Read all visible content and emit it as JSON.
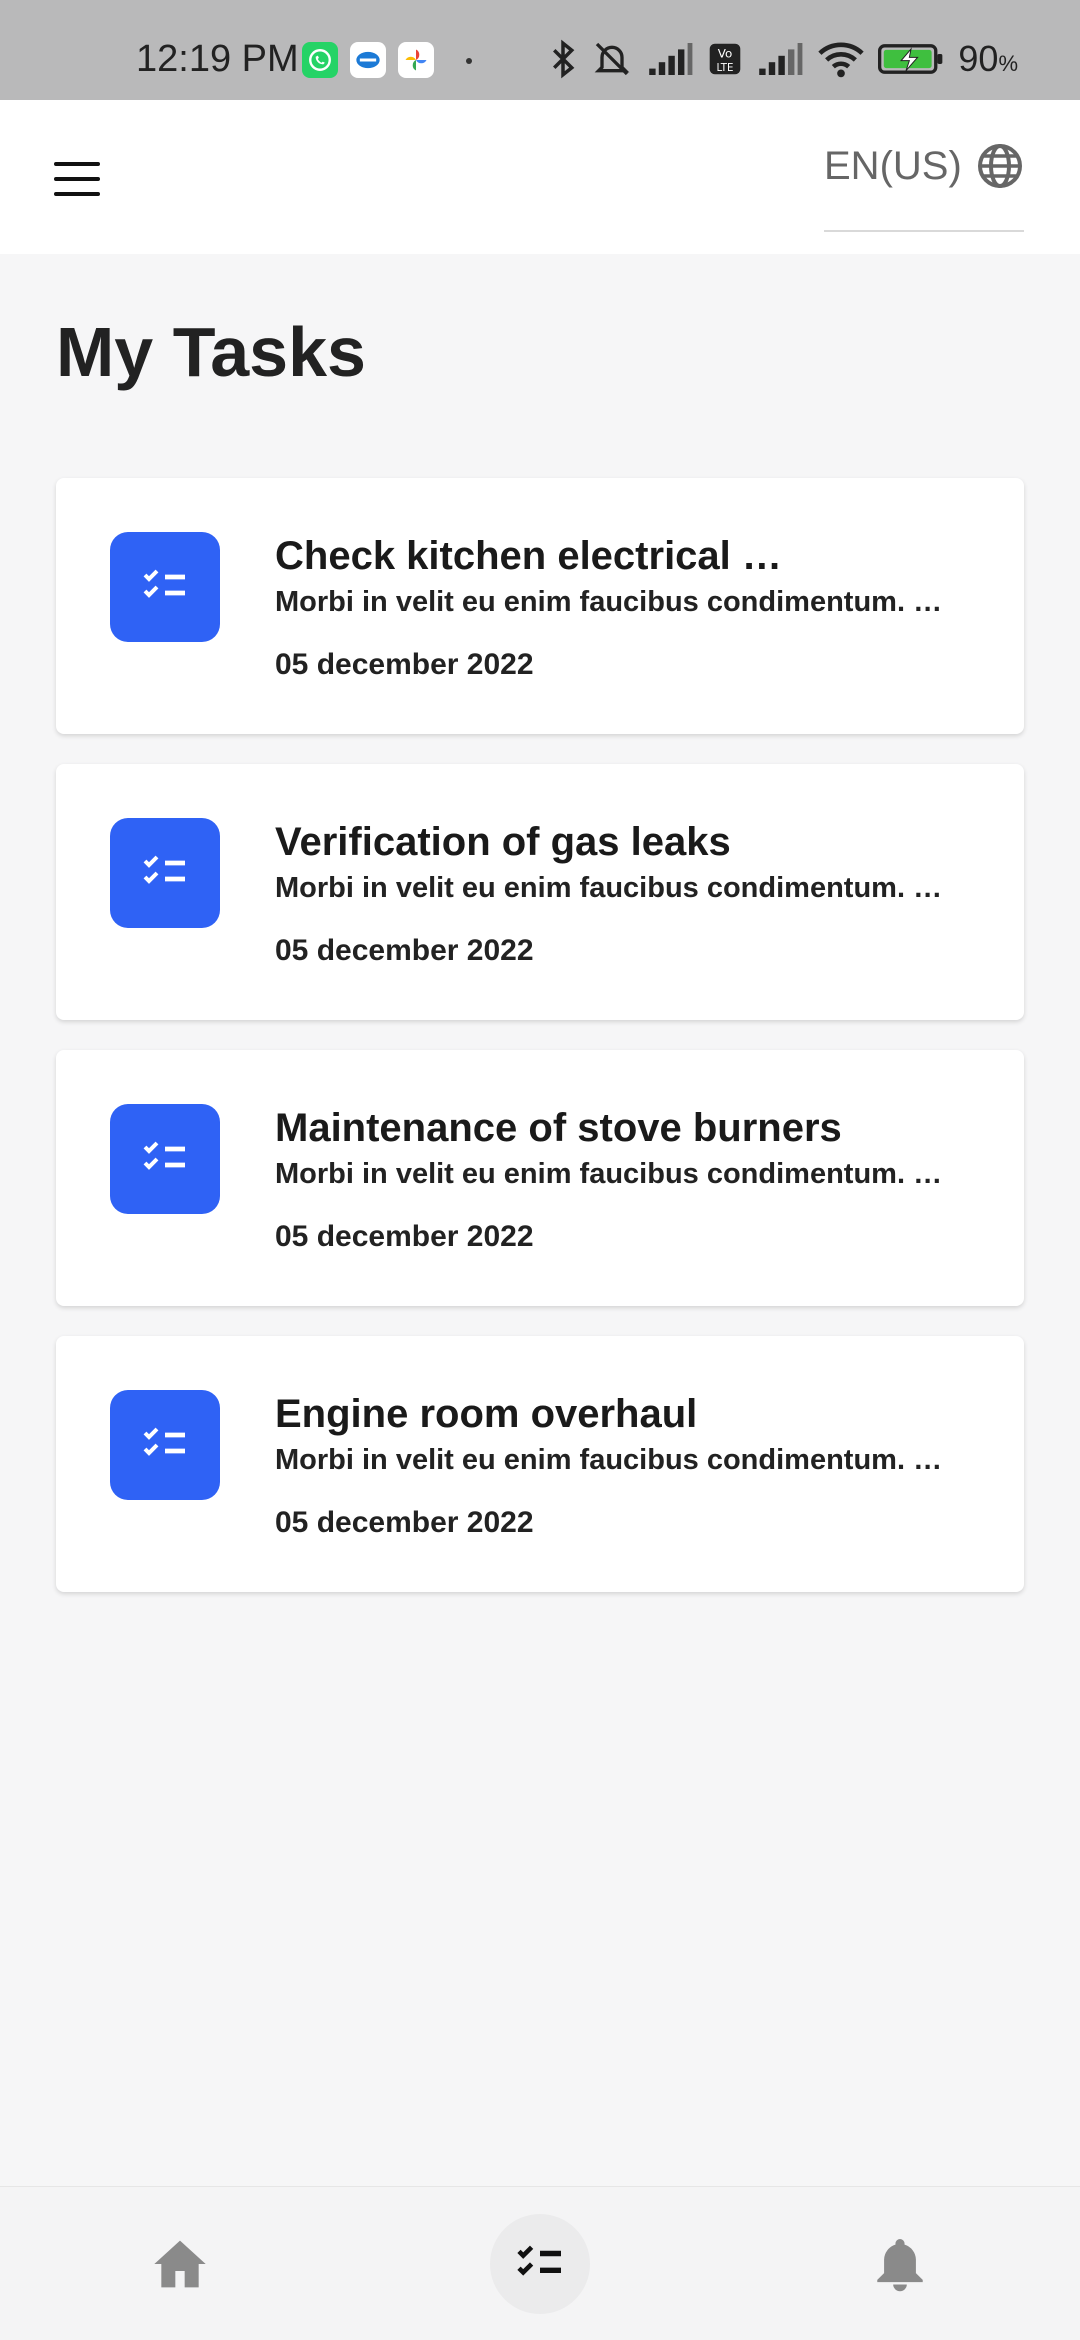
{
  "status_bar": {
    "time": "12:19 PM",
    "battery_percent": "90",
    "percent_sign": "%"
  },
  "app_bar": {
    "language": "EN(US)"
  },
  "page": {
    "title": "My Tasks"
  },
  "tasks": [
    {
      "title": "Check kitchen electrical …",
      "description": "Morbi in velit eu enim faucibus condimentum. …",
      "date": "05 december 2022"
    },
    {
      "title": "Verification of gas leaks",
      "description": "Morbi in velit eu enim faucibus condimentum. …",
      "date": "05 december 2022"
    },
    {
      "title": "Maintenance of stove burners",
      "description": "Morbi in velit eu enim faucibus condimentum. …",
      "date": "05 december 2022"
    },
    {
      "title": "Engine room overhaul",
      "description": "Morbi in velit eu enim faucibus condimentum. …",
      "date": "05 december 2022"
    }
  ],
  "icons": {
    "menu": "menu-icon",
    "language": "globe-icon",
    "task": "checklist-icon",
    "nav_home": "home-icon",
    "nav_tasks": "checklist-icon",
    "nav_notifications": "bell-icon"
  },
  "colors": {
    "accent": "#2f62f5",
    "background": "#f6f6f7",
    "card": "#ffffff",
    "nav_icon": "#8a8a8a"
  }
}
